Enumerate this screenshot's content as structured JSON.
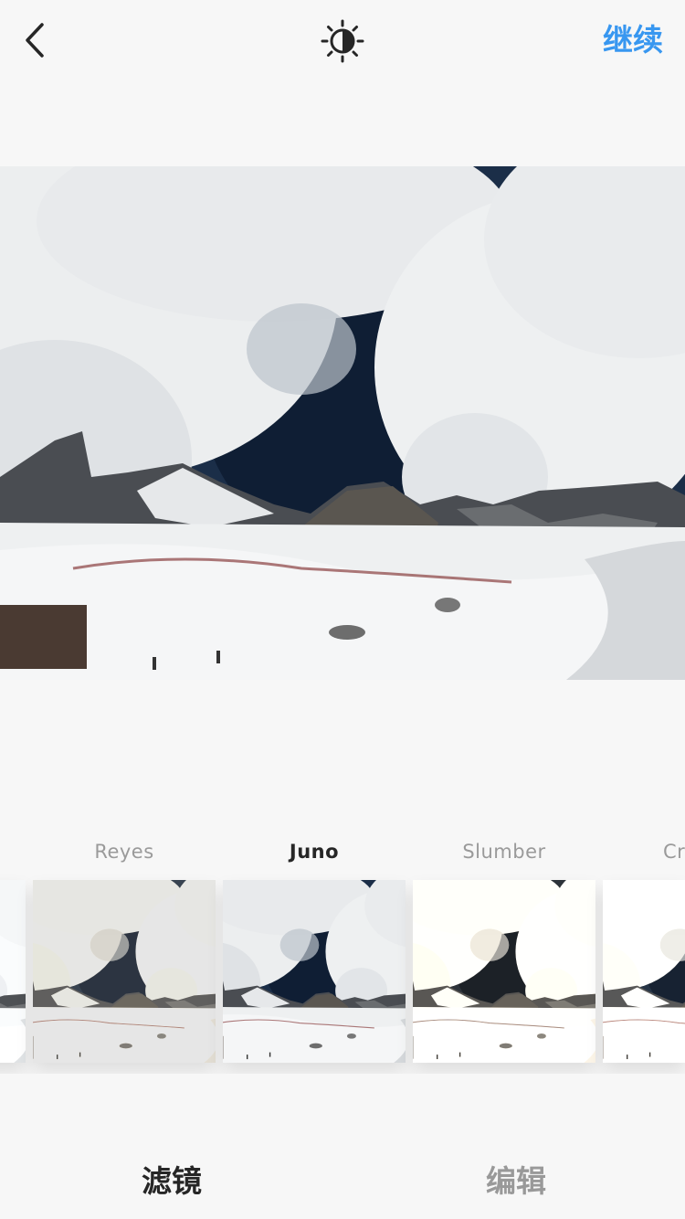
{
  "header": {
    "back_icon": "chevron-left-icon",
    "adjust_icon": "lux-sun-icon",
    "next_label": "继续",
    "accent_color": "#3897f0"
  },
  "filters": [
    {
      "name": "",
      "selected": false
    },
    {
      "name": "Reyes",
      "selected": false
    },
    {
      "name": "Juno",
      "selected": true
    },
    {
      "name": "Slumber",
      "selected": false
    },
    {
      "name": "Cr",
      "selected": false
    }
  ],
  "tabs": {
    "filter_label": "滤镜",
    "edit_label": "编辑",
    "active_color": "#262626",
    "inactive_color": "#999999"
  }
}
